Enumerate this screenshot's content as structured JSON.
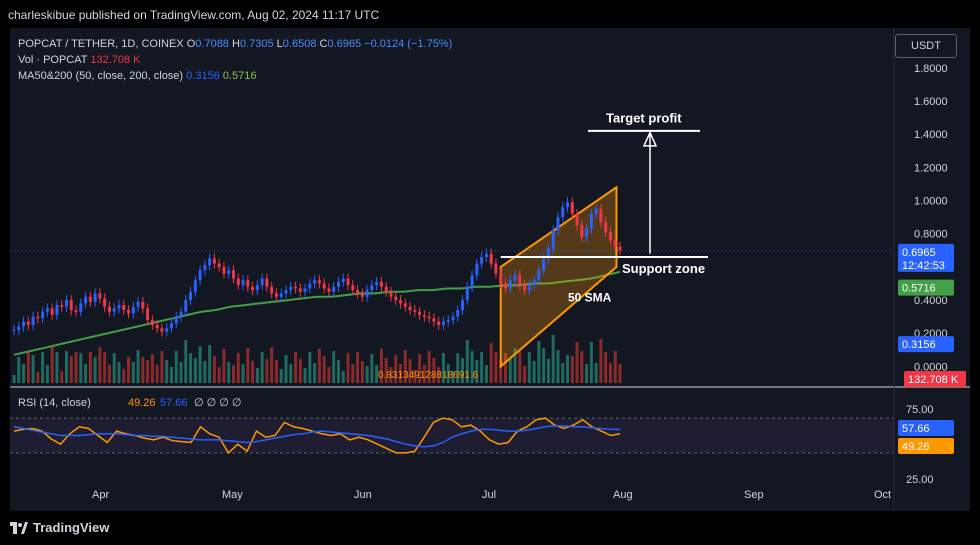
{
  "header": {
    "publisher": "charleskibue published on TradingView.com, Aug 02, 2024 11:17 UTC"
  },
  "legend": {
    "symbol": "POPCAT / TETHER, 1D, COINEX",
    "o_label": "O",
    "o_value": "0.7088",
    "h_label": "H",
    "h_value": "0.7305",
    "l_label": "L",
    "l_value": "0.6508",
    "c_label": "C",
    "c_value": "0.6965",
    "change": "−0.0124 (−1.75%)",
    "vol_label": "Vol · POPCAT",
    "vol_value": "132.708 K",
    "ma_label": "MA50&200 (50, close, 200, close)",
    "ma_fast": "0.3156",
    "ma_slow": "0.5716"
  },
  "currency_button": "USDT",
  "price_axis": [
    "1.8000",
    "1.6000",
    "1.4000",
    "1.2000",
    "1.0000",
    "0.8000",
    "0.4000",
    "0.2000",
    "0.0000"
  ],
  "price_tags": {
    "last": "0.6965",
    "countdown": "12:42:53",
    "ma_slow": "0.5716",
    "ma_fast": "0.3156",
    "volume": "132.708 K"
  },
  "rsi": {
    "label": "RSI",
    "params": "(14, close)",
    "rsi_value": "49.26",
    "ma_value": "57.66",
    "placeholders": "∅ ∅ ∅ ∅",
    "axis": [
      "75.00",
      "25.00"
    ]
  },
  "time_axis": [
    "Apr",
    "May",
    "Jun",
    "Jul",
    "Aug",
    "Sep",
    "Oct"
  ],
  "annotations": {
    "target": "Target profit",
    "support": "Support zone",
    "sma": "50 SMA",
    "fib": "0.831349128818691 6"
  },
  "colors": {
    "up": "#2962ff",
    "down": "#f23645",
    "channel": "#ff9800",
    "ma_slow": "#43a047",
    "ma_fast": "#2962ff",
    "rsi": "#ff9800",
    "rsi_ma": "#2962ff",
    "volume_up": "#1f6b5f",
    "volume_down": "#8a2a2a"
  },
  "footer": {
    "brand": "TradingView"
  },
  "chart_data": {
    "type": "candlestick",
    "title": "POPCAT / TETHER, 1D, COINEX",
    "ylabel": "USDT",
    "ylim": [
      -0.1,
      1.92
    ],
    "x_labels": [
      "Apr",
      "May",
      "Jun",
      "Jul",
      "Aug",
      "Sep",
      "Oct"
    ],
    "close_series": [
      0.22,
      0.24,
      0.27,
      0.25,
      0.3,
      0.29,
      0.33,
      0.35,
      0.31,
      0.37,
      0.36,
      0.4,
      0.34,
      0.33,
      0.38,
      0.42,
      0.39,
      0.44,
      0.41,
      0.36,
      0.33,
      0.35,
      0.37,
      0.34,
      0.32,
      0.36,
      0.39,
      0.35,
      0.28,
      0.25,
      0.23,
      0.21,
      0.23,
      0.26,
      0.3,
      0.33,
      0.4,
      0.45,
      0.52,
      0.58,
      0.61,
      0.65,
      0.62,
      0.6,
      0.56,
      0.58,
      0.53,
      0.49,
      0.52,
      0.48,
      0.46,
      0.49,
      0.53,
      0.48,
      0.44,
      0.42,
      0.44,
      0.46,
      0.48,
      0.47,
      0.45,
      0.47,
      0.5,
      0.52,
      0.5,
      0.47,
      0.45,
      0.48,
      0.51,
      0.53,
      0.49,
      0.46,
      0.44,
      0.42,
      0.46,
      0.49,
      0.51,
      0.48,
      0.45,
      0.42,
      0.4,
      0.38,
      0.36,
      0.34,
      0.33,
      0.31,
      0.3,
      0.29,
      0.27,
      0.25,
      0.27,
      0.28,
      0.3,
      0.34,
      0.4,
      0.48,
      0.55,
      0.62,
      0.66,
      0.68,
      0.62,
      0.56,
      0.5,
      0.47,
      0.52,
      0.55,
      0.49,
      0.46,
      0.49,
      0.52,
      0.58,
      0.65,
      0.71,
      0.82,
      0.9,
      0.96,
      0.99,
      0.92,
      0.85,
      0.78,
      0.83,
      0.92,
      0.95,
      0.87,
      0.81,
      0.76,
      0.72,
      0.7
    ],
    "ma200": [
      0.07,
      0.09,
      0.11,
      0.13,
      0.15,
      0.17,
      0.19,
      0.21,
      0.23,
      0.25,
      0.27,
      0.29,
      0.31,
      0.33,
      0.34,
      0.36,
      0.37,
      0.38,
      0.39,
      0.4,
      0.41,
      0.42,
      0.42,
      0.43,
      0.44,
      0.44,
      0.45,
      0.45,
      0.46,
      0.46,
      0.47,
      0.47,
      0.48,
      0.48,
      0.49,
      0.49,
      0.5,
      0.5,
      0.51,
      0.52,
      0.53,
      0.55,
      0.57
    ],
    "rsi": [
      55,
      57,
      58,
      55,
      46,
      40,
      52,
      60,
      58,
      50,
      42,
      55,
      52,
      50,
      47,
      45,
      48,
      44,
      43,
      42,
      60,
      52,
      48,
      30,
      40,
      32,
      55,
      48,
      50,
      65,
      60,
      58,
      55,
      52,
      50,
      52,
      45,
      48,
      45,
      40,
      35,
      30,
      30,
      32,
      48,
      65,
      70,
      68,
      60,
      62,
      55,
      45,
      40,
      42,
      55,
      60,
      68,
      70,
      62,
      58,
      62,
      68,
      60,
      55,
      50,
      52
    ],
    "rsi_ma": [
      60,
      58,
      56,
      54,
      52,
      50,
      50,
      50,
      51,
      52,
      52,
      52,
      51,
      50,
      50,
      49,
      49,
      48,
      47,
      46,
      45,
      45,
      45,
      44,
      43,
      42,
      43,
      45,
      47,
      49,
      51,
      52,
      54,
      55,
      54,
      53,
      52,
      51,
      50,
      48,
      46,
      43,
      40,
      38,
      37,
      38,
      42,
      48,
      52,
      55,
      57,
      57,
      56,
      55,
      55,
      56,
      58,
      60,
      61,
      61,
      60,
      60,
      59,
      58,
      57,
      57
    ]
  }
}
